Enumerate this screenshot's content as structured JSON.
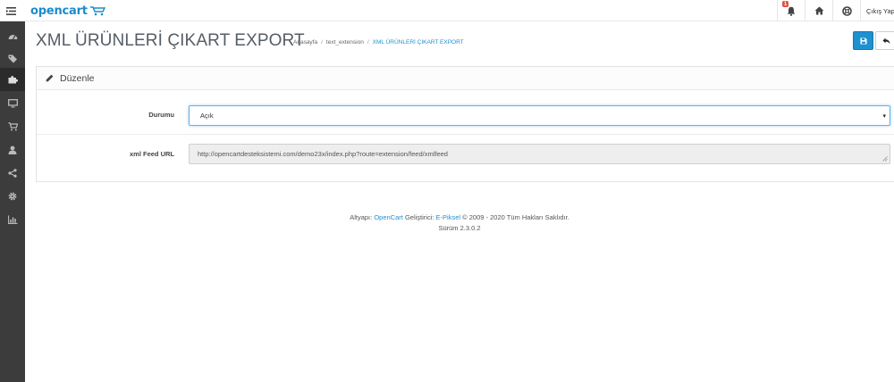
{
  "header": {
    "logo_text": "opencart",
    "notification_count": "1",
    "logout_label": "Çıkış Yap"
  },
  "sidebar": {
    "items": [
      {
        "icon": "dashboard-icon"
      },
      {
        "icon": "tags-icon"
      },
      {
        "icon": "puzzle-icon"
      },
      {
        "icon": "monitor-icon"
      },
      {
        "icon": "shopping-cart-icon"
      },
      {
        "icon": "user-icon"
      },
      {
        "icon": "share-icon"
      },
      {
        "icon": "gear-icon"
      },
      {
        "icon": "bar-chart-icon"
      }
    ]
  },
  "page": {
    "title": "XML ÜRÜNLERİ ÇIKART EXPORT",
    "breadcrumb": [
      "Anasayfa",
      "text_extension",
      "XML ÜRÜNLERİ ÇIKART EXPORT"
    ]
  },
  "panel": {
    "heading": "Düzenle",
    "status_label": "Durumu",
    "status_value": "Açık",
    "feed_label": "xml Feed URL",
    "feed_value": "http://opencartdesteksistemi.com/demo23x/index.php?route=extension/feed/xmlfeed"
  },
  "footer": {
    "prefix": "Altyapı:",
    "platform": "OpenCart",
    "developer_prefix": "Geliştirici:",
    "developer": "E-Piksel",
    "copyright": "© 2009 - 2020 Tüm Hakları Saklıdır.",
    "version": "Sürüm 2.3.0.2"
  },
  "colors": {
    "accent": "#1e91cf",
    "sidebar_bg": "#3c3c3c",
    "badge": "#e3503e"
  }
}
